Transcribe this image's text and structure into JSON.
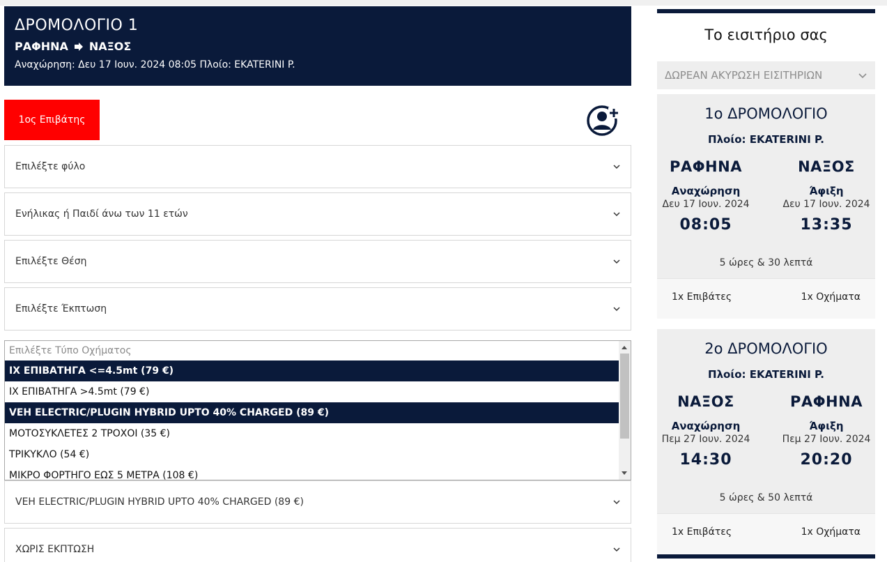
{
  "route": {
    "title": "ΔΡΟΜΟΛΟΓΙΟ 1",
    "from": "ΡΑΦΗΝΑ",
    "to": "ΝΑΞΟΣ",
    "meta": "Αναχώρηση: Δευ 17 Ιουν. 2024 08:05 Πλοίο: EKATERINI P."
  },
  "passenger_tab": "1ος Επιβάτης",
  "fields": {
    "gender": "Επιλέξτε φύλο",
    "age": "Ενήλικας ή Παιδί άνω των 11 ετών",
    "seat": "Επιλέξτε Θέση",
    "discount": "Επιλέξτε Έκπτωση",
    "vehicle_selected": "VEH ELECTRIC/PLUGIN HYBRID UPTO 40% CHARGED (89 €)",
    "vehicle_discount": "ΧΩΡΙΣ ΕΚΠΤΩΣΗ"
  },
  "vehicle_list": {
    "placeholder": "Επιλέξτε Τύπο Οχήματος",
    "options": [
      "ΙΧ ΕΠΙΒΑΤΗΓΑ <=4.5mt (79 €)",
      "ΙΧ ΕΠΙΒΑΤΗΓΑ >4.5mt (79 €)",
      "VEH ELECTRIC/PLUGIN HYBRID UPTO 40% CHARGED (89 €)",
      "ΜΟΤΟΣΥΚΛΕΤΕΣ 2 ΤΡΟΧΟΙ (35 €)",
      "ΤΡΙΚΥΚΛΟ (54 €)",
      "ΜΙΚΡΟ ΦΟΡΤΗΓΟ ΕΩΣ 5 ΜΕΤΡΑ (108 €)"
    ]
  },
  "summary": {
    "title": "Το εισιτήριο σας",
    "cancel": "ΔΩΡΕΑΝ ΑΚΥΡΩΣΗ ΕΙΣΙΤΗΡΙΩΝ",
    "trips": [
      {
        "title": "1ο ΔΡΟΜΟΛΟΓΙΟ",
        "ship": "Πλοίο: EKATERINI P.",
        "from": "ΡΑΦΗΝΑ",
        "to": "ΝΑΞΟΣ",
        "dep_label": "Αναχώρηση",
        "arr_label": "Άφιξη",
        "dep_date": "Δευ 17 Ιουν. 2024",
        "arr_date": "Δευ 17 Ιουν. 2024",
        "dep_time": "08:05",
        "arr_time": "13:35",
        "duration": "5 ώρες & 30 λεπτά",
        "passengers": "1x Επιβάτες",
        "vehicles": "1x Οχήματα"
      },
      {
        "title": "2ο ΔΡΟΜΟΛΟΓΙΟ",
        "ship": "Πλοίο: EKATERINI P.",
        "from": "ΝΑΞΟΣ",
        "to": "ΡΑΦΗΝΑ",
        "dep_label": "Αναχώρηση",
        "arr_label": "Άφιξη",
        "dep_date": "Πεμ 27 Ιουν. 2024",
        "arr_date": "Πεμ 27 Ιουν. 2024",
        "dep_time": "14:30",
        "arr_time": "20:20",
        "duration": "5 ώρες & 50 λεπτά",
        "passengers": "1x Επιβάτες",
        "vehicles": "1x Οχήματα"
      }
    ]
  },
  "colors": {
    "navy": "#0a1a3a",
    "red": "#ff0000"
  },
  "icons": {
    "arrow": "arrow-right-icon",
    "add_user": "add-user-icon",
    "chevron": "chevron-down-icon"
  }
}
